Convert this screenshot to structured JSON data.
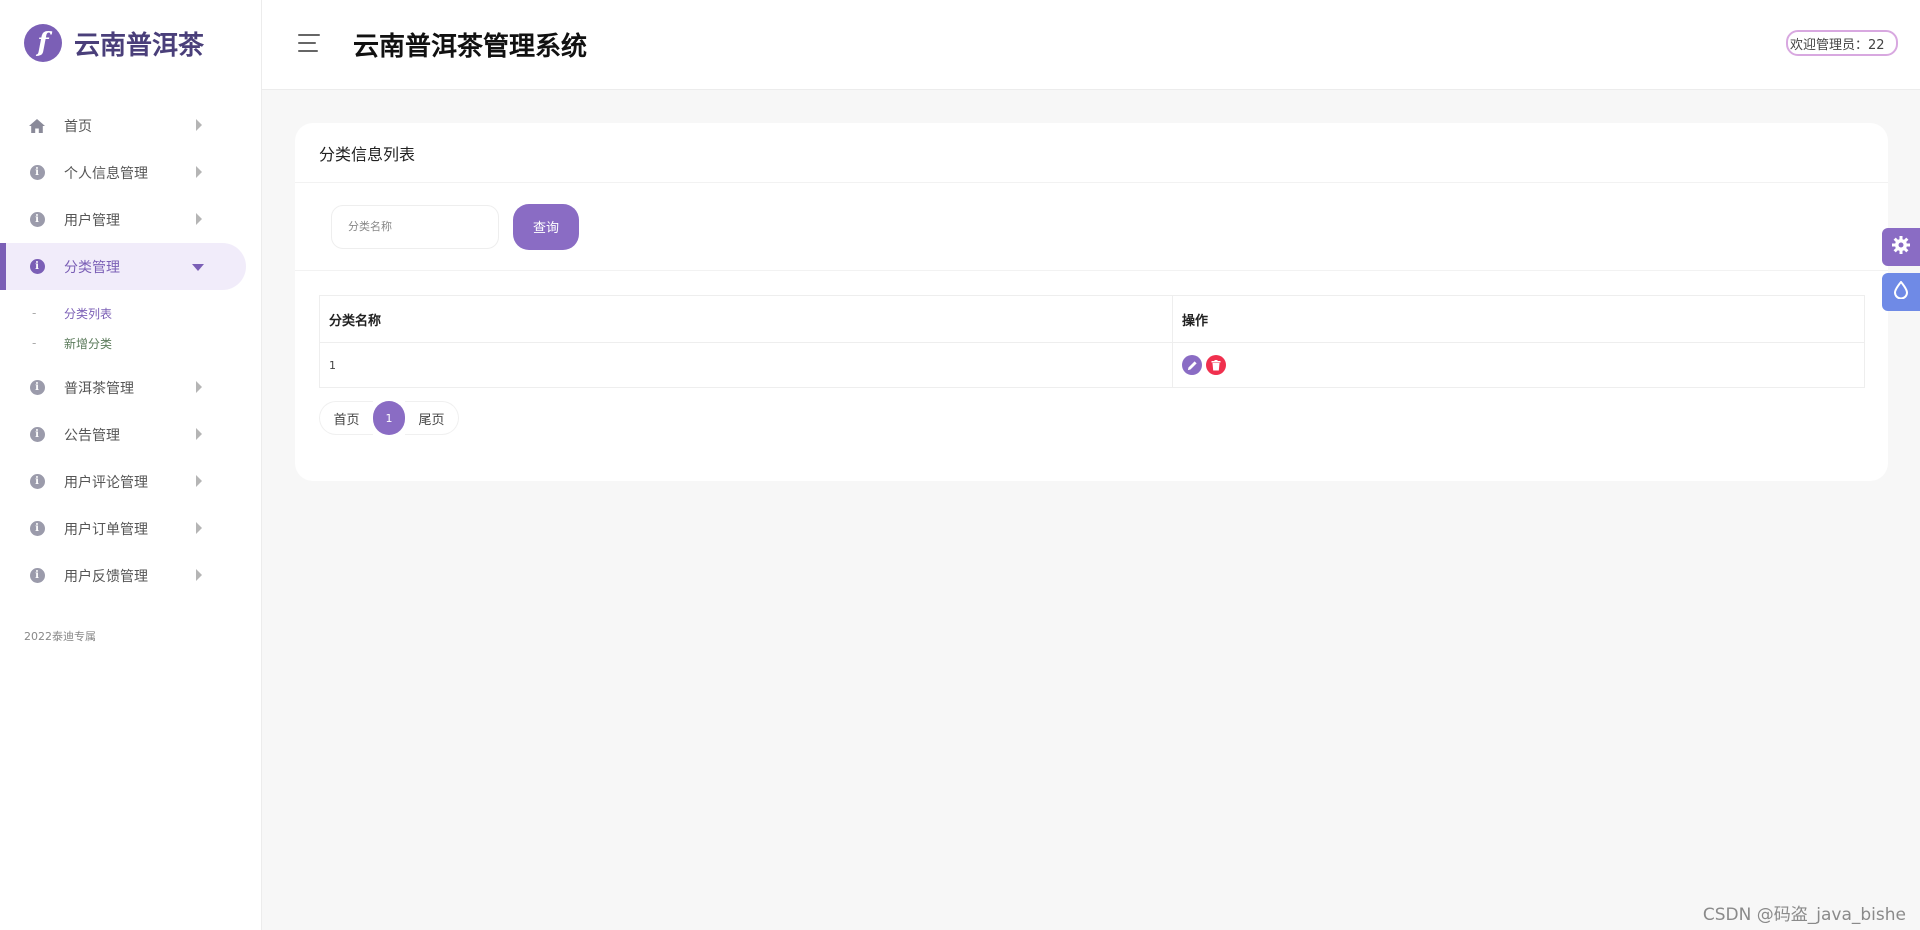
{
  "brand": {
    "logo_letter": "f",
    "name": "云南普洱茶"
  },
  "header": {
    "title": "云南普洱茶管理系统",
    "welcome": "欢迎管理员：22"
  },
  "sidebar": {
    "items": [
      {
        "label": "首页",
        "icon": "home-icon"
      },
      {
        "label": "个人信息管理",
        "icon": "info-icon"
      },
      {
        "label": "用户管理",
        "icon": "info-icon"
      },
      {
        "label": "分类管理",
        "icon": "info-icon",
        "active": true,
        "children": [
          {
            "label": "分类列表",
            "current": true
          },
          {
            "label": "新增分类"
          }
        ]
      },
      {
        "label": "普洱茶管理",
        "icon": "info-icon"
      },
      {
        "label": "公告管理",
        "icon": "info-icon"
      },
      {
        "label": "用户评论管理",
        "icon": "info-icon"
      },
      {
        "label": "用户订单管理",
        "icon": "info-icon"
      },
      {
        "label": "用户反馈管理",
        "icon": "info-icon"
      }
    ],
    "sub_dash": "-",
    "copyright": "2022泰迪专属"
  },
  "card": {
    "title": "分类信息列表",
    "search": {
      "placeholder": "分类名称",
      "value": "",
      "button": "查询"
    },
    "table": {
      "headers": [
        "分类名称",
        "操作"
      ],
      "rows": [
        {
          "name": "1"
        }
      ]
    },
    "pager": {
      "first": "首页",
      "current": "1",
      "last": "尾页"
    }
  },
  "colors": {
    "accent": "#8a6cc4",
    "danger": "#f0304e",
    "theme_btn": "#6f8ae6"
  },
  "watermark": "CSDN @码盗_java_bishe"
}
